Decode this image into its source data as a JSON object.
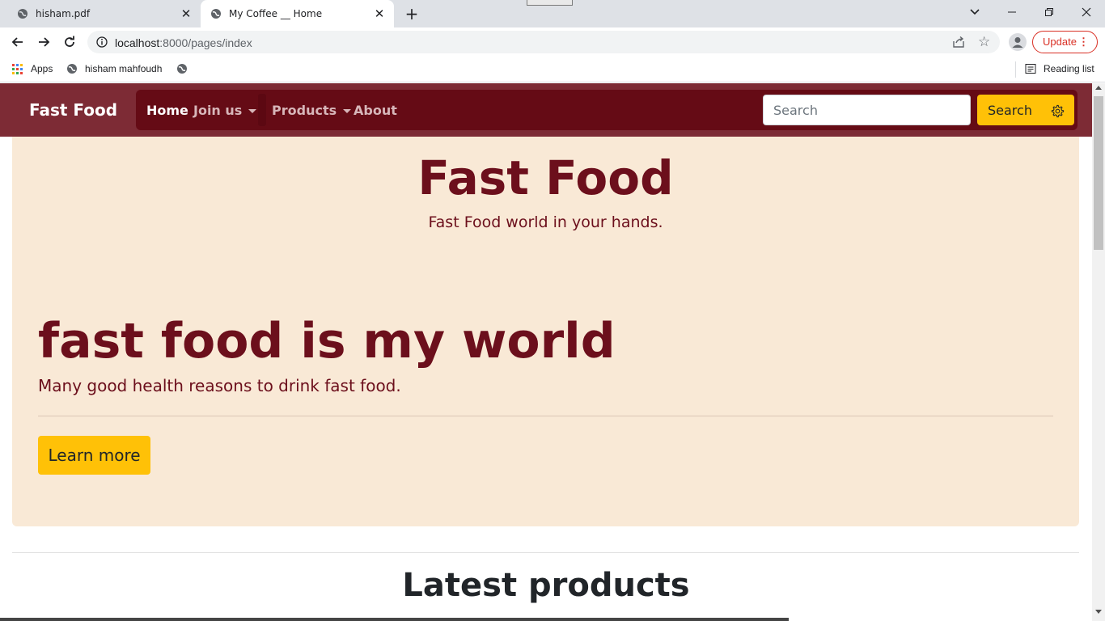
{
  "browser": {
    "tabs": [
      {
        "title": "hisham.pdf",
        "active": false
      },
      {
        "title": "My Coffee __ Home",
        "active": true
      }
    ],
    "url_host": "localhost",
    "url_path": ":8000/pages/index",
    "update_label": "Update",
    "bookmarks": {
      "apps": "Apps",
      "item1": "hisham mahfoudh",
      "reading_list": "Reading list"
    }
  },
  "navbar": {
    "brand": "Fast Food",
    "links": {
      "home": "Home",
      "join": "Join us",
      "products": "Products",
      "about": "About"
    },
    "search_placeholder": "Search",
    "search_button": "Search"
  },
  "hero": {
    "title": "Fast Food",
    "subtitle": "Fast Food world in your hands.",
    "jumbo_title": "fast food is my world",
    "jumbo_text": "Many good health reasons to drink fast food.",
    "cta": "Learn more"
  },
  "section": {
    "latest_title": "Latest products"
  },
  "colors": {
    "navbar": "#7d2b35",
    "nav_pill": "#650b15",
    "accent_button": "#ffc107",
    "hero_bg": "#f9e9d6",
    "hero_text": "#6c0f1c"
  }
}
